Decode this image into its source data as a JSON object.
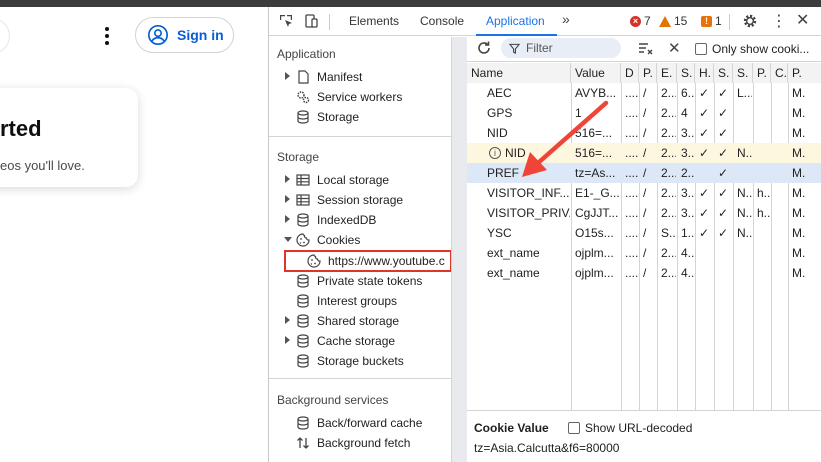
{
  "page": {
    "signin_label": "Sign in",
    "card_title": "rted",
    "card_sub": "eos you'll love."
  },
  "devtools": {
    "tabs": [
      "Elements",
      "Console",
      "Application"
    ],
    "active_tab": "Application",
    "errors": "7",
    "warnings": "15",
    "issues": "1"
  },
  "sidebar": {
    "application_header": "Application",
    "application_items": [
      "Manifest",
      "Service workers",
      "Storage"
    ],
    "storage_header": "Storage",
    "storage_items": [
      "Local storage",
      "Session storage",
      "IndexedDB",
      "Cookies",
      "https://www.youtube.c",
      "Private state tokens",
      "Interest groups",
      "Shared storage",
      "Cache storage",
      "Storage buckets"
    ],
    "background_header": "Background services",
    "background_items": [
      "Back/forward cache",
      "Background fetch"
    ]
  },
  "cookie_toolbar": {
    "filter_placeholder": "Filter",
    "only_show_label": "Only show cooki..."
  },
  "cookie_table": {
    "headers": [
      "Name",
      "Value",
      "D",
      "P.",
      "E.",
      "S.",
      "H.",
      "S.",
      "S.",
      "P.",
      "C.",
      "P."
    ],
    "rows": [
      [
        "AEC",
        "AVYB...",
        "....",
        "/",
        "2...",
        "6...",
        "✓",
        "✓",
        "L...",
        "",
        "",
        "M."
      ],
      [
        "GPS",
        "1",
        "....",
        "/",
        "2...",
        "4",
        "✓",
        "✓",
        "",
        "",
        "",
        "M."
      ],
      [
        "NID",
        "516=...",
        "....",
        "/",
        "2...",
        "3...",
        "✓",
        "✓",
        "",
        "",
        "",
        "M."
      ],
      [
        "NID",
        "516=...",
        "....",
        "/",
        "2...",
        "3...",
        "✓",
        "✓",
        "N...",
        "",
        "",
        "M."
      ],
      [
        "PREF",
        "tz=As...",
        "....",
        "/",
        "2...",
        "2...",
        "",
        "✓",
        "",
        "",
        "",
        "M."
      ],
      [
        "VISITOR_INF...",
        "E1-_G...",
        "....",
        "/",
        "2...",
        "3...",
        "✓",
        "✓",
        "N...",
        "h...",
        "",
        "M."
      ],
      [
        "VISITOR_PRIV...",
        "CgJJT...",
        "....",
        "/",
        "2...",
        "3...",
        "✓",
        "✓",
        "N...",
        "h...",
        "",
        "M."
      ],
      [
        "YSC",
        "O15s...",
        "....",
        "/",
        "S...",
        "1...",
        "✓",
        "✓",
        "N...",
        "",
        "",
        "M."
      ],
      [
        "ext_name",
        "ojplm...",
        "....",
        "/",
        "2...",
        "4...",
        "",
        "",
        "",
        "",
        "",
        "M."
      ],
      [
        "ext_name",
        "ojplm...",
        "....",
        "/",
        "2...",
        "4...",
        "",
        "",
        "",
        "",
        "",
        "M."
      ]
    ]
  },
  "cookie_value": {
    "header": "Cookie Value",
    "show_decoded_label": "Show URL-decoded",
    "value": "tz=Asia.Calcutta&f6=80000"
  },
  "colors": {
    "accent": "#1a73e8",
    "highlight_box": "#e0342a",
    "arrow": "#f04438",
    "selected_row": "#dce8f8",
    "warn_row": "#fef7e0"
  }
}
